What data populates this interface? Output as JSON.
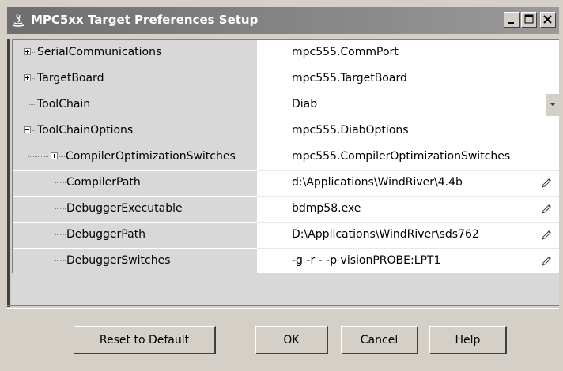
{
  "window": {
    "title": "MPC5xx Target Preferences Setup",
    "icon": "matlab-java-icon",
    "controls": [
      "minimize-icon",
      "maximize-icon",
      "close-icon"
    ]
  },
  "properties": [
    {
      "name": "SerialCommunications",
      "value": "mpc555.CommPort",
      "expander": "plus",
      "level": 0
    },
    {
      "name": "TargetBoard",
      "value": "mpc555.TargetBoard",
      "expander": "plus",
      "level": 0
    },
    {
      "name": "ToolChain",
      "value": "Diab",
      "expander": "none",
      "level": 0,
      "editor": "dropdown"
    },
    {
      "name": "ToolChainOptions",
      "value": "mpc555.DiabOptions",
      "expander": "minus",
      "level": 0
    },
    {
      "name": "CompilerOptimizationSwitches",
      "value": "mpc555.CompilerOptimizationSwitches",
      "expander": "plus",
      "level": 1
    },
    {
      "name": "CompilerPath",
      "value": "d:\\Applications\\WindRiver\\4.4b",
      "expander": "none",
      "level": 1,
      "editor": "pencil"
    },
    {
      "name": "DebuggerExecutable",
      "value": "bdmp58.exe",
      "expander": "none",
      "level": 1,
      "editor": "pencil"
    },
    {
      "name": "DebuggerPath",
      "value": "D:\\Applications\\WindRiver\\sds762",
      "expander": "none",
      "level": 1,
      "editor": "pencil"
    },
    {
      "name": "DebuggerSwitches",
      "value": "-g -r - -p visionPROBE:LPT1",
      "expander": "none",
      "level": 1,
      "editor": "pencil"
    }
  ],
  "buttons": {
    "reset": "Reset to Default",
    "ok": "OK",
    "cancel": "Cancel",
    "help": "Help"
  }
}
